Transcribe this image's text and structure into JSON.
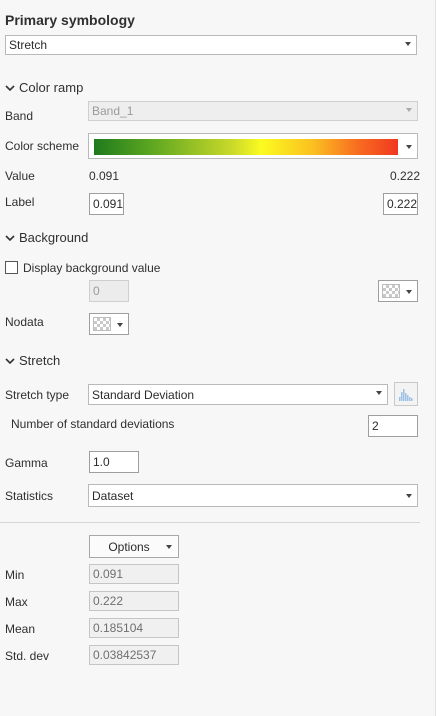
{
  "primary_symbology": {
    "title": "Primary symbology",
    "value": "Stretch"
  },
  "color_ramp": {
    "title": "Color ramp",
    "band_label": "Band",
    "band_value": "Band_1",
    "scheme_label": "Color scheme",
    "value_label": "Value",
    "value_min": "0.091",
    "value_max": "0.222",
    "label_label": "Label",
    "label_min": "0.091",
    "label_max": "0.222"
  },
  "background": {
    "title": "Background",
    "display_label": "Display background value",
    "bg_value": "0",
    "nodata_label": "Nodata"
  },
  "stretch": {
    "title": "Stretch",
    "type_label": "Stretch type",
    "type_value": "Standard Deviation",
    "nstd_label": "Number of standard deviations",
    "nstd_value": "2",
    "gamma_label": "Gamma",
    "gamma_value": "1.0",
    "stats_label": "Statistics",
    "stats_value": "Dataset"
  },
  "statistics": {
    "options_label": "Options",
    "min_label": "Min",
    "min_value": "0.091",
    "max_label": "Max",
    "max_value": "0.222",
    "mean_label": "Mean",
    "mean_value": "0.185104",
    "std_label": "Std. dev",
    "std_value": "0.03842537"
  },
  "colors": {
    "ramp_start": "#1e7a1e",
    "ramp_mid": "#fbfb20",
    "ramp_end": "#f03820"
  }
}
